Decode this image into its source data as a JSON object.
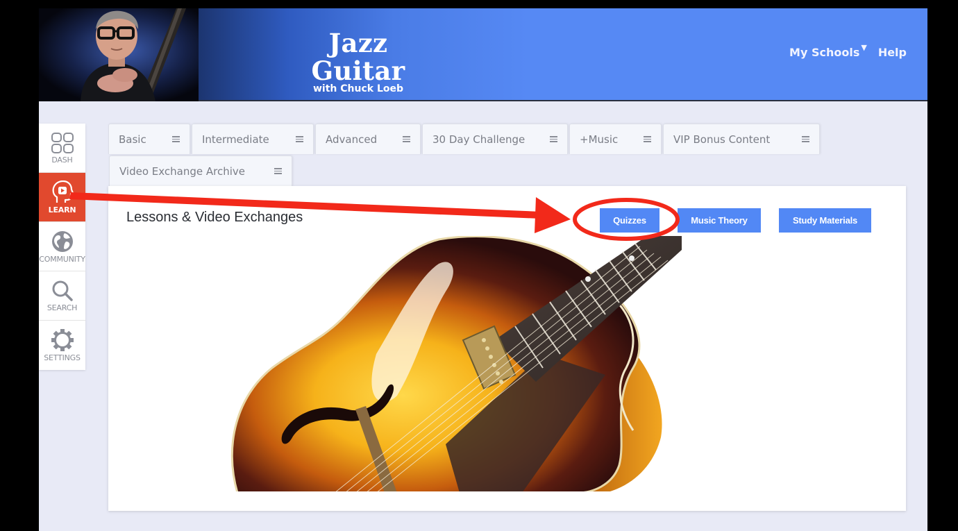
{
  "header": {
    "brand_title": "Jazz Guitar",
    "brand_subtitle": "with Chuck Loeb",
    "nav": [
      {
        "label": "My Schools",
        "has_dropdown": true,
        "caret": "▼"
      },
      {
        "label": "Help",
        "has_dropdown": false
      }
    ],
    "colors": {
      "banner_blue": "#5689f4"
    }
  },
  "sidebar": {
    "items": [
      {
        "label": "DASH",
        "icon": "grid-icon",
        "active": false
      },
      {
        "label": "LEARN",
        "icon": "learn-head-icon",
        "active": true
      },
      {
        "label": "COMMUNITY",
        "icon": "globe-icon",
        "active": false
      },
      {
        "label": "SEARCH",
        "icon": "search-icon",
        "active": false
      },
      {
        "label": "SETTINGS",
        "icon": "gear-icon",
        "active": false
      }
    ],
    "colors": {
      "active": "#e1492e"
    }
  },
  "tabs": [
    {
      "label": "Basic"
    },
    {
      "label": "Intermediate"
    },
    {
      "label": "Advanced"
    },
    {
      "label": "30 Day Challenge"
    },
    {
      "label": "+Music"
    },
    {
      "label": "VIP Bonus Content"
    },
    {
      "label": "Video Exchange Archive"
    }
  ],
  "main": {
    "title": "Lessons & Video Exchanges",
    "buttons": [
      {
        "label": "Quizzes",
        "highlighted": true
      },
      {
        "label": "Music Theory"
      },
      {
        "label": "Study Materials"
      }
    ],
    "hero_image": "archtop sunburst jazz guitar",
    "colors": {
      "button": "#5288f5"
    }
  },
  "annotation": {
    "type": "arrow-and-circle",
    "from": "sidebar LEARN",
    "to": "Quizzes button",
    "color": "#f2291a"
  }
}
